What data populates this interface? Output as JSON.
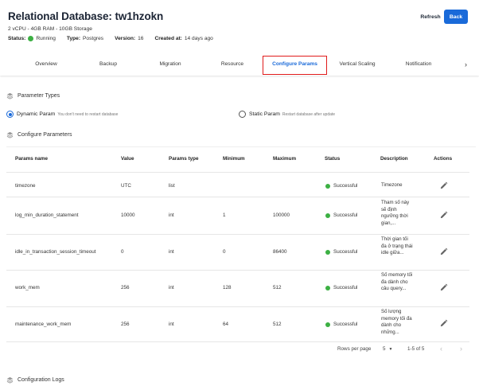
{
  "header": {
    "title": "Relational Database: tw1hzokn",
    "specs": "2 vCPU - 4GB RAM - 10GB Storage",
    "status_label": "Status:",
    "status_value": "Running",
    "type_label": "Type:",
    "type_value": "Postgres",
    "version_label": "Version:",
    "version_value": "16",
    "created_label": "Created at:",
    "created_value": "14 days ago",
    "refresh_label": "Refresh",
    "back_label": "Back",
    "status_color": "#3cb043",
    "accent_color": "#1a6ad9"
  },
  "tabs": [
    "Overview",
    "Backup",
    "Migration",
    "Resource",
    "Configure Params",
    "Vertical Scaling",
    "Notification"
  ],
  "tabs_more_icon": "chevron-right-icon",
  "sections": {
    "param_types": "Parameter Types",
    "configure_params": "Configure Parameters",
    "config_logs": "Configuration Logs"
  },
  "param_type_options": {
    "dynamic_label": "Dynamic Param",
    "dynamic_hint": "You don't need to restart database",
    "static_label": "Static Param",
    "static_hint": "Restart database after update",
    "selected": "dynamic"
  },
  "table": {
    "headers": [
      "Params name",
      "Value",
      "Params type",
      "Minimum",
      "Maximum",
      "Status",
      "Description",
      "Actions"
    ],
    "rows": [
      {
        "name": "timezone",
        "value": "UTC",
        "type": "list",
        "min": "",
        "max": "",
        "status": "Successful",
        "desc": "Timezone"
      },
      {
        "name": "log_min_duration_statement",
        "value": "10000",
        "type": "int",
        "min": "1",
        "max": "100000",
        "status": "Successful",
        "desc": "Tham số này sẽ định ngưỡng thời gian,..."
      },
      {
        "name": "idle_in_transaction_session_timeout",
        "value": "0",
        "type": "int",
        "min": "0",
        "max": "86400",
        "status": "Successful",
        "desc": "Thời gian tối đa ở trạng thái idle giữa..."
      },
      {
        "name": "work_mem",
        "value": "256",
        "type": "int",
        "min": "128",
        "max": "512",
        "status": "Successful",
        "desc": "Số memory tối đa dành cho câu query..."
      },
      {
        "name": "maintenance_work_mem",
        "value": "256",
        "type": "int",
        "min": "64",
        "max": "512",
        "status": "Successful",
        "desc": "Số lượng memory tối đa dành cho những..."
      }
    ]
  },
  "pagination": {
    "rows_per_page_label": "Rows per page",
    "rows_per_page_value": "5",
    "range": "1-5 of 5"
  }
}
